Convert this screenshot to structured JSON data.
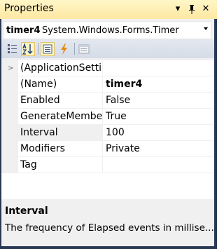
{
  "window": {
    "title": "Properties",
    "dropdown_icon": "▾",
    "pin_icon": "◊",
    "close_icon": "✕"
  },
  "object_selector": {
    "name": "timer4",
    "type": "System.Windows.Forms.Timer"
  },
  "toolbar": {
    "buttons": [
      "categorized-icon",
      "alphabetical-icon",
      "properties-icon",
      "events-icon",
      "property-pages-icon"
    ],
    "active": [
      "alphabetical-icon",
      "properties-icon"
    ]
  },
  "properties": [
    {
      "name": "(ApplicationSettings)",
      "value": "",
      "expandable": true
    },
    {
      "name": "(Name)",
      "value": "timer4",
      "bold": true
    },
    {
      "name": "Enabled",
      "value": "False"
    },
    {
      "name": "GenerateMember",
      "value": "True"
    },
    {
      "name": "Interval",
      "value": "100",
      "selected": true
    },
    {
      "name": "Modifiers",
      "value": "Private"
    },
    {
      "name": "Tag",
      "value": ""
    }
  ],
  "help": {
    "title": "Interval",
    "description": "The frequency of Elapsed events in millise..."
  },
  "colors": {
    "chrome": "#293955",
    "titlebar": "#fde8a3",
    "toolbar": "#dce2eb",
    "panel": "#f0f0f0"
  }
}
